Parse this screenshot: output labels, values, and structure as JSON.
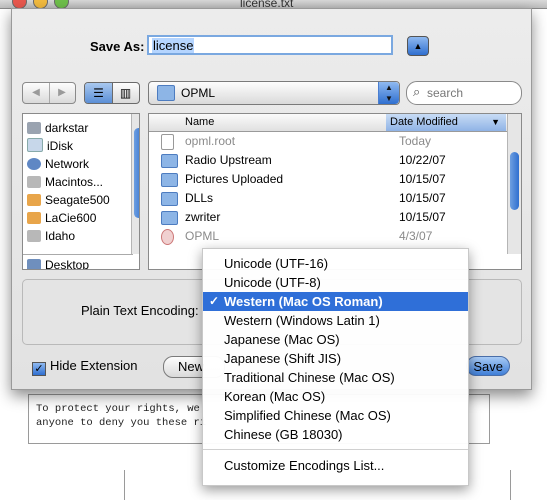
{
  "background_window": {
    "title": "license.txt",
    "text_lines": [
      "To protect your rights, we",
      "anyone to deny you these ri"
    ]
  },
  "save_panel": {
    "save_as_label": "Save As:",
    "filename": "license",
    "location": "OPML",
    "search_placeholder": "search",
    "sidebar": [
      {
        "label": "darkstar",
        "icon": "computer-icon"
      },
      {
        "label": "iDisk",
        "icon": "idisk-icon"
      },
      {
        "label": "Network",
        "icon": "network-icon"
      },
      {
        "label": "Macintos...",
        "icon": "hard-drive-icon"
      },
      {
        "label": "Seagate500",
        "icon": "hard-drive-icon"
      },
      {
        "label": "LaCie600",
        "icon": "hard-drive-icon"
      },
      {
        "label": "Idaho",
        "icon": "hard-drive-icon"
      },
      {
        "label": "Desktop",
        "icon": "desktop-icon"
      }
    ],
    "columns": {
      "name": "Name",
      "date": "Date Modified"
    },
    "files": [
      {
        "name": "opml.root",
        "date": "Today",
        "dim": true,
        "icon": "document-icon"
      },
      {
        "name": "Radio Upstream",
        "date": "10/22/07",
        "dim": false,
        "icon": "folder-icon"
      },
      {
        "name": "Pictures Uploaded",
        "date": "10/15/07",
        "dim": false,
        "icon": "folder-icon"
      },
      {
        "name": "DLLs",
        "date": "10/15/07",
        "dim": false,
        "icon": "folder-icon"
      },
      {
        "name": "zwriter",
        "date": "10/15/07",
        "dim": false,
        "icon": "folder-icon"
      },
      {
        "name": "OPML",
        "date": "4/3/07",
        "dim": true,
        "icon": "opml-icon"
      }
    ],
    "encoding_label": "Plain Text Encoding:",
    "hide_extension_label": "Hide Extension",
    "hide_extension_checked": true,
    "new_folder_label": "New",
    "save_label": "Save"
  },
  "encoding_menu": {
    "items": [
      {
        "label": "Unicode (UTF-16)",
        "selected": false
      },
      {
        "label": "Unicode (UTF-8)",
        "selected": false
      },
      {
        "label": "Western (Mac OS Roman)",
        "selected": true
      },
      {
        "label": "Western (Windows Latin 1)",
        "selected": false
      },
      {
        "label": "Japanese (Mac OS)",
        "selected": false
      },
      {
        "label": "Japanese (Shift JIS)",
        "selected": false
      },
      {
        "label": "Traditional Chinese (Mac OS)",
        "selected": false
      },
      {
        "label": "Korean (Mac OS)",
        "selected": false
      },
      {
        "label": "Simplified Chinese (Mac OS)",
        "selected": false
      },
      {
        "label": "Chinese (GB 18030)",
        "selected": false
      }
    ],
    "footer_item": "Customize Encodings List...",
    "checkmark": "✓"
  },
  "colors": {
    "accent": "#2f6fd8",
    "selection": "#b5d5ff"
  }
}
